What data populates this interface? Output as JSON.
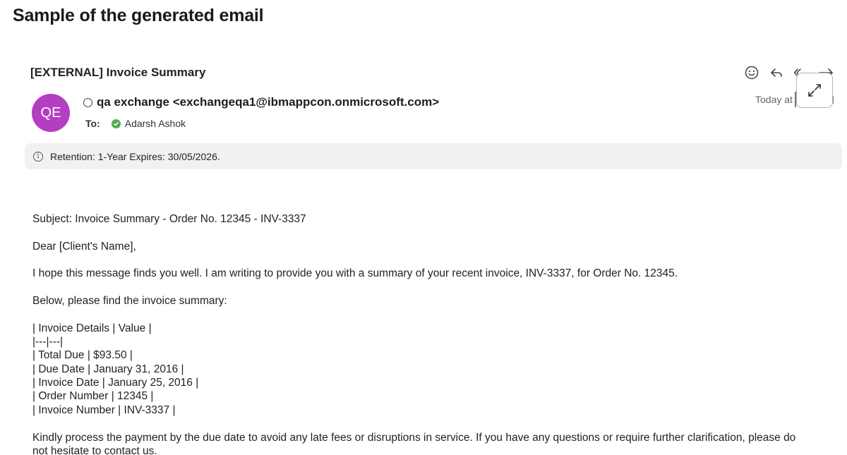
{
  "page": {
    "heading": "Sample of the generated email"
  },
  "email": {
    "subject": "[EXTERNAL] Invoice Summary",
    "avatar_initials": "QE",
    "sender": "qa exchange <exchangeqa1@ibmappcon.onmicrosoft.com>",
    "to_label": "To:",
    "recipient": "Adarsh Ashok",
    "date": "Today at",
    "retention": "Retention: 1-Year Expires: 30/05/2026.",
    "actions": [
      "smiley-icon",
      "reply-icon",
      "forward-icon",
      "expand-icon"
    ]
  },
  "body": {
    "subject_line": "Subject: Invoice Summary - Order No. 12345 - INV-3337",
    "greeting": "Dear [Client's Name],",
    "intro": "I hope this message finds you well. I am writing to provide you with a summary of your recent invoice, INV-3337, for Order No. 12345.",
    "lead_in": "Below, please find the invoice summary:",
    "table_lines": [
      "| Invoice Details | Value |",
      "|---|---|",
      "| Total Due | $93.50 |",
      "| Due Date | January 31, 2016 |",
      "| Invoice Date | January 25, 2016 |",
      "| Order Number | 12345 |",
      "| Invoice Number | INV-3337 |"
    ],
    "closing_line1": "Kindly process the payment by the due date to avoid any late fees or disruptions in service. If you have any questions or require further clarification, please do",
    "closing_line2": "not hesitate to contact us."
  }
}
